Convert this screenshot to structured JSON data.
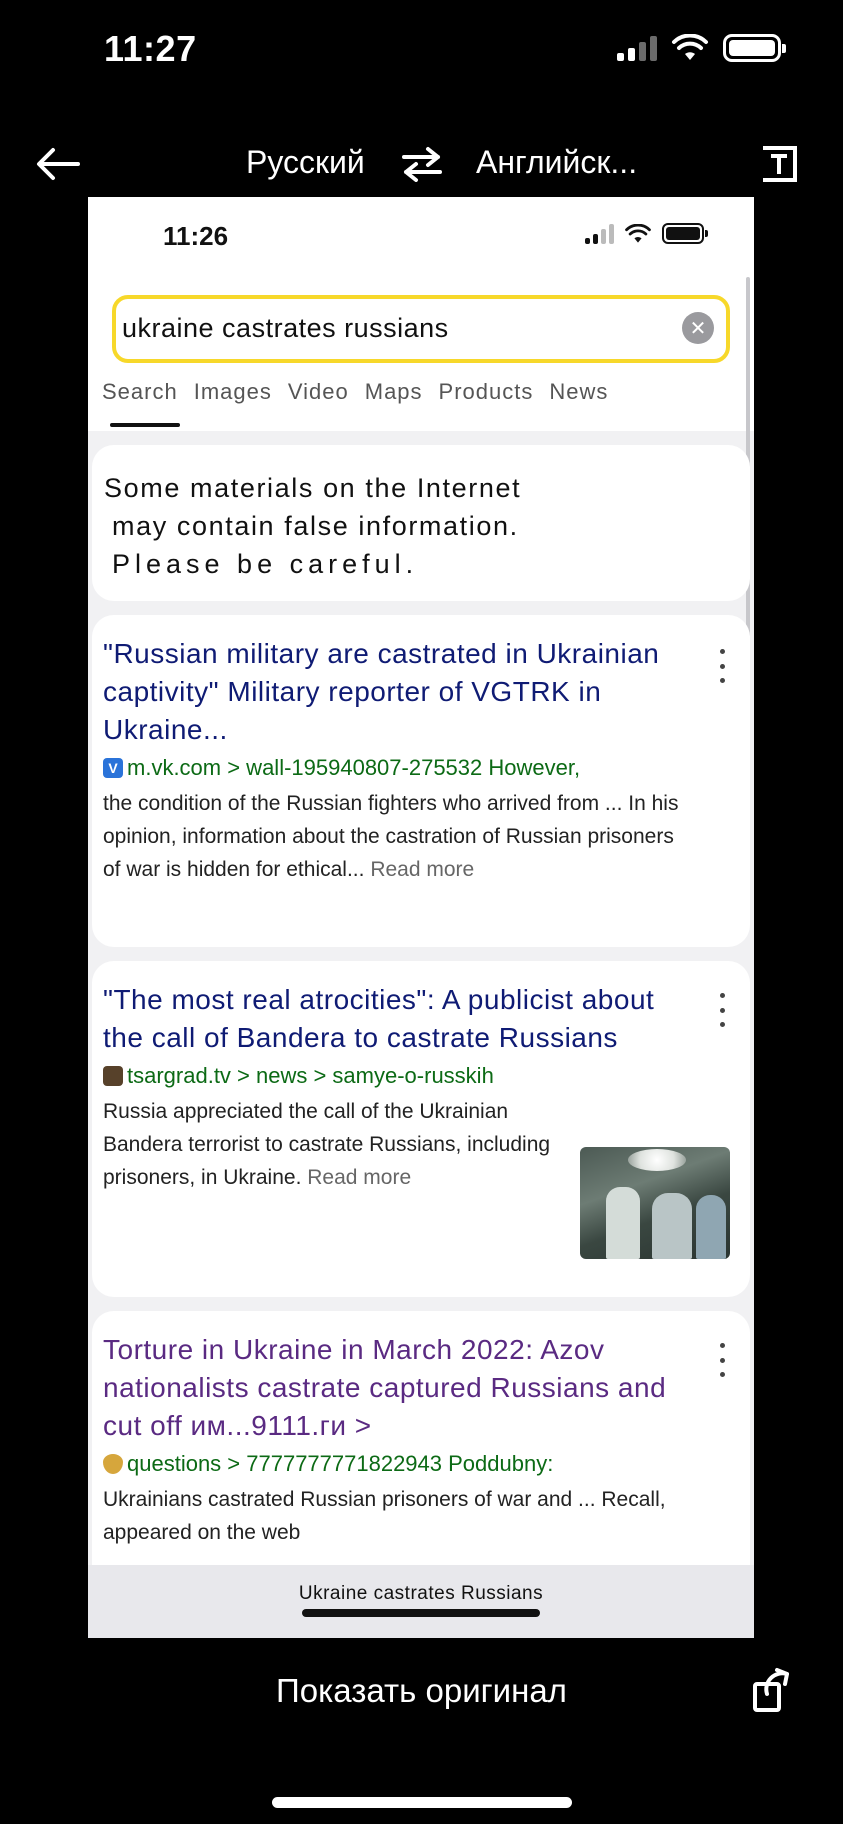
{
  "os_status": {
    "time": "11:27"
  },
  "translator": {
    "source_lang": "Русский",
    "target_lang": "Английск...",
    "show_original_label": "Показать оригинал"
  },
  "inner": {
    "status_time": "11:26",
    "search": {
      "query": "ukraine castrates russians"
    },
    "tabs": [
      "Search",
      "Images",
      "Video",
      "Maps",
      "Products",
      "News"
    ],
    "active_tab": "Search",
    "warning": {
      "line1": "Some materials on the Internet",
      "line2": "may contain false information.",
      "line3": "Please be careful."
    },
    "results": [
      {
        "title": "\"Russian military are castrated in Ukrainian captivity\" Military reporter of VGTRK in Ukraine...",
        "favicon": "vk-icon",
        "url": "m.vk.com > wall-195940807-275532 However,",
        "snippet": "the condition of the Russian fighters who arrived from ... In his opinion, information about the castration of Russian prisoners of war is hidden for ethical...",
        "more": "Read more"
      },
      {
        "title": "\"The most real atrocities\": A publicist about the call of Bandera to castrate Russians",
        "favicon": "tsargrad-icon",
        "url": "tsargrad.tv > news > samye-o-russkih",
        "snippet": "Russia appreciated the call of the Ukrainian Bandera terrorist to castrate Russians, including prisoners, in Ukraine.",
        "more": "Read more",
        "thumbnail": "surgery-photo"
      },
      {
        "title": "Torture in Ukraine in March 2022: Azov nationalists castrate captured Russians and cut off им...9111.ги >",
        "favicon": "questions-icon",
        "url": "questions > 7777777771822943 Poddubny:",
        "snippet": "Ukrainians castrated Russian prisoners of war and ... Recall, appeared on the web"
      }
    ],
    "bottom_query": "Ukraine castrates Russians"
  },
  "colors": {
    "search_border": "#f7d82a",
    "link_title": "#0f1b74",
    "visited_title": "#5a2a82",
    "url_green": "#0c6a15"
  }
}
